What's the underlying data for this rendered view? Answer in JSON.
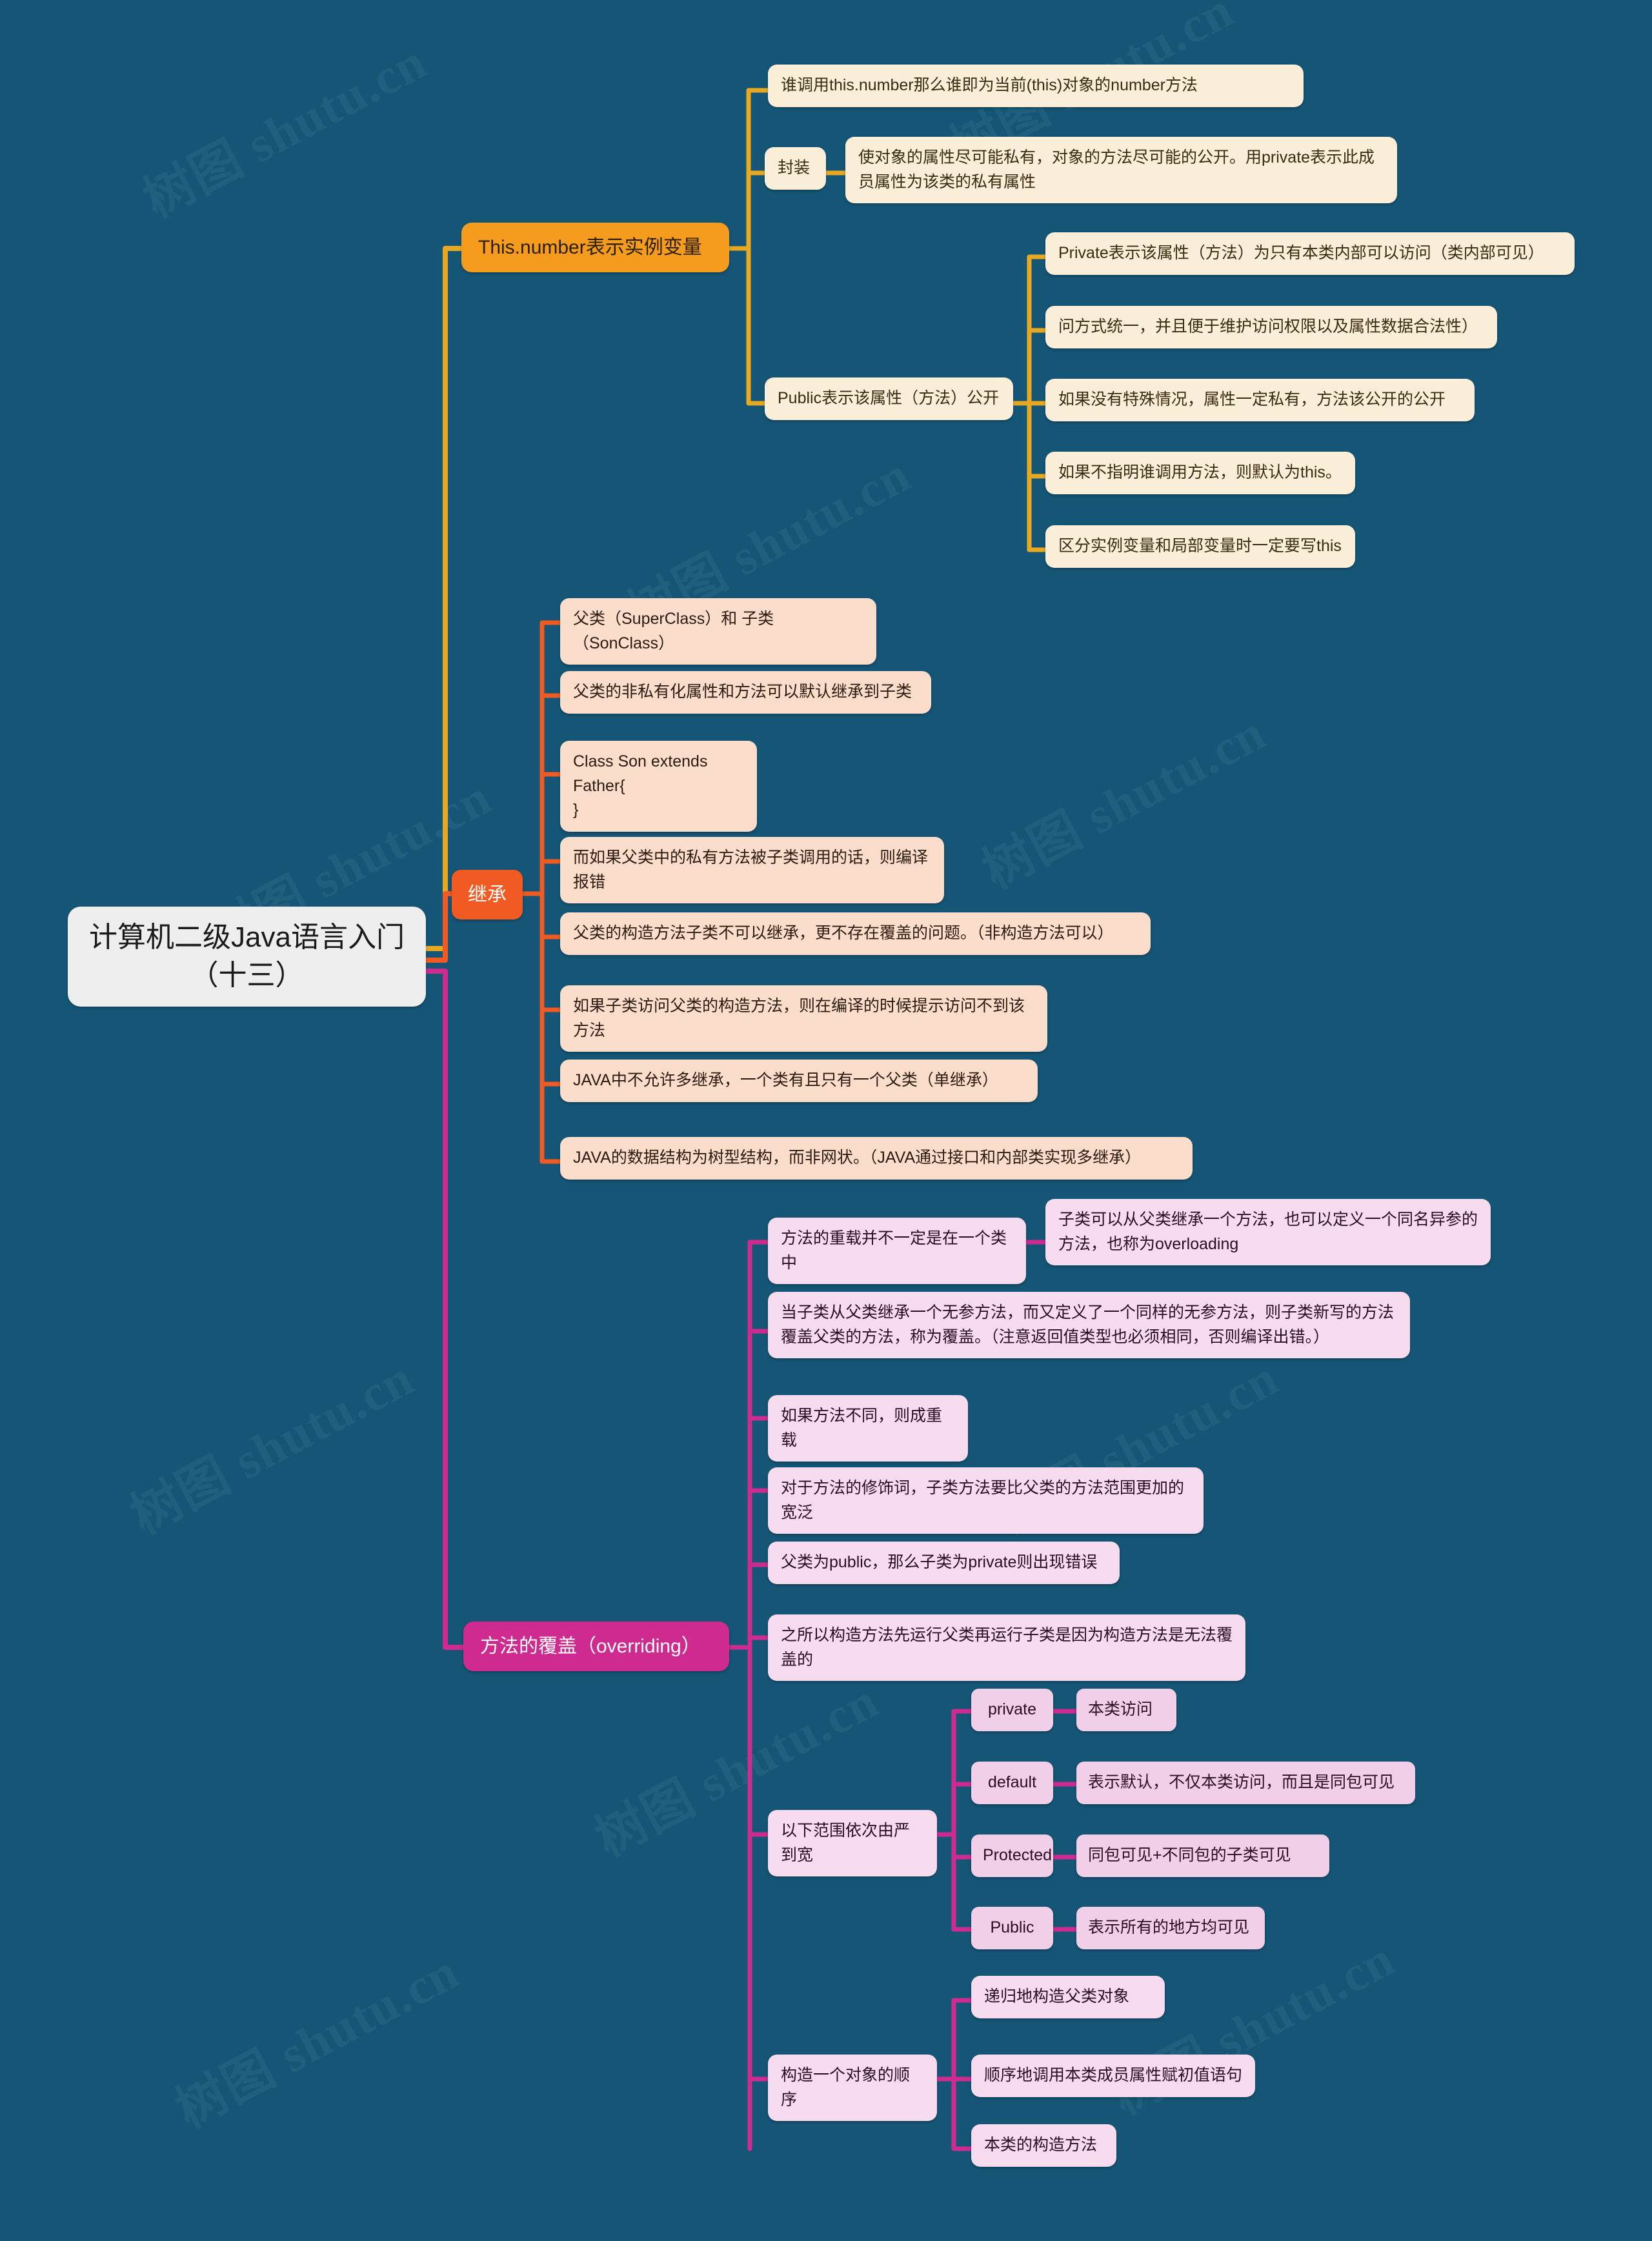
{
  "meta": {
    "background_color": "#155677",
    "watermark_text": "树图 shutu.cn"
  },
  "root": {
    "label": "计算机二级Java语言入门（十三）"
  },
  "branches": [
    {
      "id": "branch-this-number",
      "label": "This.number表示实例变量",
      "color": "#f59b1e",
      "children": [
        {
          "label": "谁调用this.number那么谁即为当前(this)对象的number方法",
          "children": []
        },
        {
          "label": "封装",
          "children": [
            {
              "label": "使对象的属性尽可能私有，对象的方法尽可能的公开。用private表示此成员属性为该类的私有属性"
            }
          ]
        },
        {
          "label": "Public表示该属性（方法）公开",
          "children": [
            {
              "label": "Private表示该属性（方法）为只有本类内部可以访问（类内部可见）"
            },
            {
              "label": "问方式统一，并且便于维护访问权限以及属性数据合法性）"
            },
            {
              "label": "如果没有特殊情况，属性一定私有，方法该公开的公开"
            },
            {
              "label": "如果不指明谁调用方法，则默认为this。"
            },
            {
              "label": "区分实例变量和局部变量时一定要写this"
            }
          ]
        }
      ]
    },
    {
      "id": "branch-inheritance",
      "label": "继承",
      "color": "#f15a22",
      "children": [
        {
          "label": "父类（SuperClass）和 子类（SonClass）"
        },
        {
          "label": "父类的非私有化属性和方法可以默认继承到子类"
        },
        {
          "label": "Class Son extends Father{\n}"
        },
        {
          "label": "而如果父类中的私有方法被子类调用的话，则编译报错"
        },
        {
          "label": "父类的构造方法子类不可以继承，更不存在覆盖的问题。（非构造方法可以）"
        },
        {
          "label": "如果子类访问父类的构造方法，则在编译的时候提示访问不到该方法"
        },
        {
          "label": "JAVA中不允许多继承，一个类有且只有一个父类（单继承）"
        },
        {
          "label": "JAVA的数据结构为树型结构，而非网状。（JAVA通过接口和内部类实现多继承）"
        }
      ]
    },
    {
      "id": "branch-overriding",
      "label": "方法的覆盖（overriding）",
      "color": "#cf2a8f",
      "children": [
        {
          "label": "方法的重载并不一定是在一个类中",
          "children": [
            {
              "label": "子类可以从父类继承一个方法，也可以定义一个同名异参的方法，也称为overloading"
            }
          ]
        },
        {
          "label": "当子类从父类继承一个无参方法，而又定义了一个同样的无参方法，则子类新写的方法覆盖父类的方法，称为覆盖。（注意返回值类型也必须相同，否则编译出错。）"
        },
        {
          "label": "如果方法不同，则成重载"
        },
        {
          "label": "对于方法的修饰词，子类方法要比父类的方法范围更加的宽泛"
        },
        {
          "label": "父类为public，那么子类为private则出现错误"
        },
        {
          "label": "之所以构造方法先运行父类再运行子类是因为构造方法是无法覆盖的"
        },
        {
          "label": "以下范围依次由严到宽",
          "children": [
            {
              "label": "private",
              "detail": "本类访问"
            },
            {
              "label": "default",
              "detail": "表示默认，不仅本类访问，而且是同包可见"
            },
            {
              "label": "Protected",
              "detail": "同包可见+不同包的子类可见"
            },
            {
              "label": "Public",
              "detail": "表示所有的地方均可见"
            }
          ]
        },
        {
          "label": "构造一个对象的顺序",
          "children": [
            {
              "label": "递归地构造父类对象"
            },
            {
              "label": "顺序地调用本类成员属性赋初值语句"
            },
            {
              "label": "本类的构造方法"
            }
          ]
        }
      ]
    }
  ]
}
